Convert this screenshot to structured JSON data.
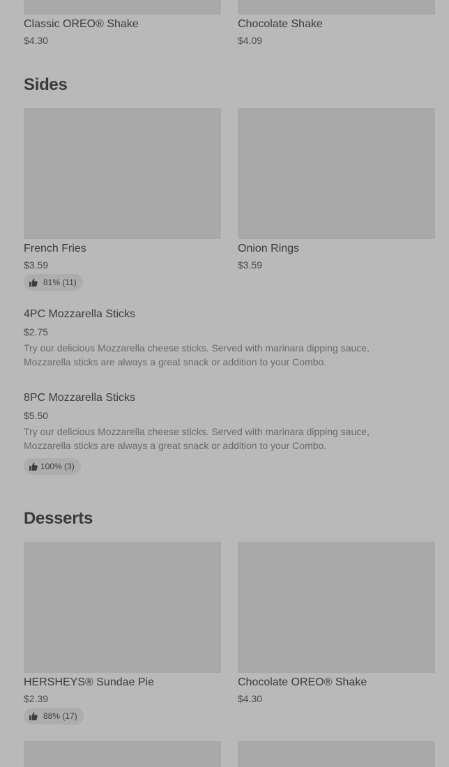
{
  "shakes_row": {
    "items": [
      {
        "name": "Classic OREO® Shake",
        "price": "$4.30"
      },
      {
        "name": "Chocolate Shake",
        "price": "$4.09"
      }
    ]
  },
  "sides": {
    "title": "Sides",
    "cards": [
      {
        "name": "French Fries",
        "price": "$3.59",
        "rating": "81% (11)"
      },
      {
        "name": "Onion Rings",
        "price": "$3.59"
      }
    ],
    "list": [
      {
        "name": "4PC Mozzarella Sticks",
        "price": "$2.75",
        "description": "Try our delicious Mozzarella cheese sticks. Served with marinara dipping sauce, Mozzarella sticks are always a great snack or addition to your Combo."
      },
      {
        "name": "8PC Mozzarella Sticks",
        "price": "$5.50",
        "description": "Try our delicious Mozzarella cheese sticks. Served with marinara dipping sauce, Mozzarella sticks are always a great snack or addition to your Combo.",
        "rating": "100% (3)"
      }
    ]
  },
  "desserts": {
    "title": "Desserts",
    "cards": [
      {
        "name": "HERSHEYS® Sundae Pie",
        "price": "$2.39",
        "rating": "88% (17)"
      },
      {
        "name": "Chocolate OREO® Shake",
        "price": "$4.30"
      }
    ]
  },
  "icons": {
    "rating": "thumbs-up-icon"
  },
  "colors": {
    "background": "#b9b9b9",
    "image_placeholder": "#a9a9a9",
    "badge": "#adadad"
  }
}
